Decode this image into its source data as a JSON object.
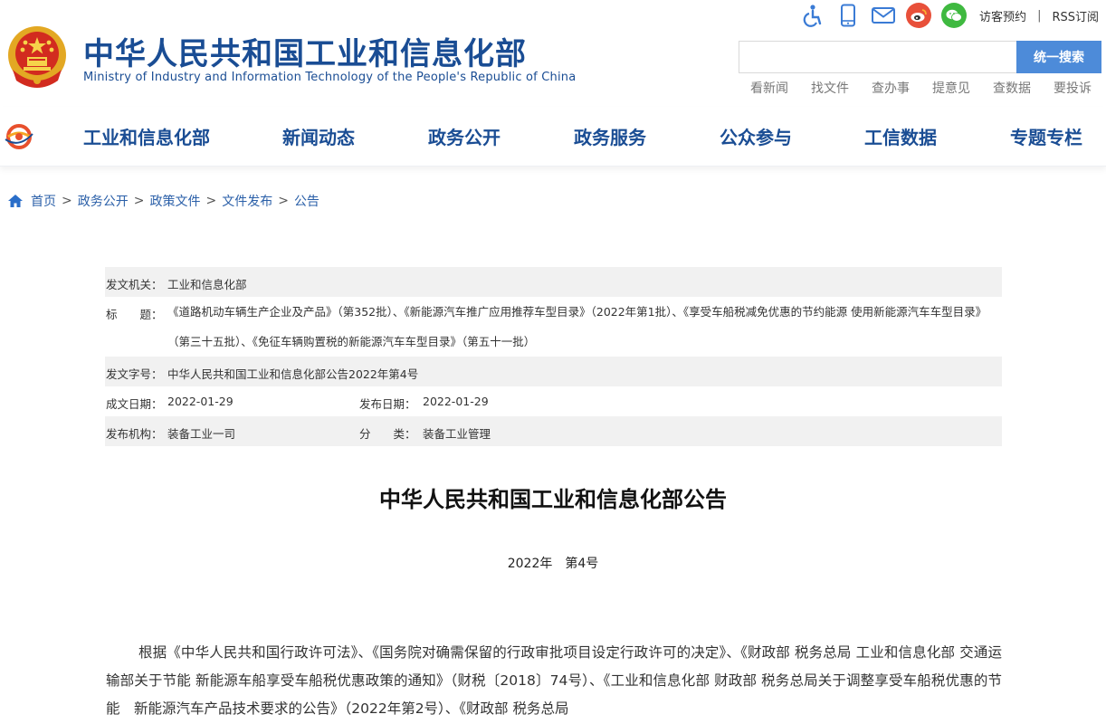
{
  "header": {
    "site_title": "中华人民共和国工业和信息化部",
    "site_subtitle": "Ministry of Industry and Information Technology of the People's Republic of China",
    "top_links": {
      "visitor_booking": "访客预约",
      "separator": "|",
      "rss": "RSS订阅"
    },
    "search": {
      "placeholder": "",
      "button_label": "统一搜索"
    },
    "quick_links": [
      "看新闻",
      "找文件",
      "查办事",
      "提意见",
      "查数据",
      "要投诉"
    ]
  },
  "nav": {
    "items": [
      "工业和信息化部",
      "新闻动态",
      "政务公开",
      "政务服务",
      "公众参与",
      "工信数据",
      "专题专栏"
    ]
  },
  "breadcrumb": {
    "items": [
      "首页",
      "政务公开",
      "政策文件",
      "文件发布",
      "公告"
    ],
    "separator": ">"
  },
  "meta": {
    "issuer_label": "发文机关：",
    "issuer": "工业和信息化部",
    "title_label": "标　　题：",
    "title": "《道路机动车辆生产企业及产品》（第352批）、《新能源汽车推广应用推荐车型目录》（2022年第1批）、《享受车船税减免优惠的节约能源 使用新能源汽车车型目录》（第三十五批）、《免征车辆购置税的新能源汽车车型目录》（第五十一批）",
    "doc_no_label": "发文字号：",
    "doc_no": "中华人民共和国工业和信息化部公告2022年第4号",
    "created_label": "成文日期：",
    "created": "2022-01-29",
    "published_label": "发布日期：",
    "published": "2022-01-29",
    "org_label": "发布机构：",
    "org": "装备工业一司",
    "category_label": "分　　类：",
    "category": "装备工业管理"
  },
  "document": {
    "title": "中华人民共和国工业和信息化部公告",
    "number": "2022年　第4号",
    "body": "根据《中华人民共和国行政许可法》、《国务院对确需保留的行政审批项目设定行政许可的决定》、《财政部 税务总局 工业和信息化部 交通运输部关于节能 新能源车船享受车船税优惠政策的通知》（财税〔2018〕74号）、《工业和信息化部 财政部 税务总局关于调整享受车船税优惠的节能　新能源汽车产品技术要求的公告》（2022年第2号）、《财政部 税务总局"
  },
  "colors": {
    "brand_blue": "#1a4d94",
    "link_blue": "#2a5fa8",
    "search_button": "#4d8bd9",
    "weibo_red": "#e8503a",
    "wechat_green": "#3fb940"
  },
  "icons": [
    "accessibility-icon",
    "mobile-icon",
    "mail-icon",
    "weibo-icon",
    "wechat-icon",
    "home-icon",
    "national-emblem-icon",
    "miit-logo-icon"
  ]
}
